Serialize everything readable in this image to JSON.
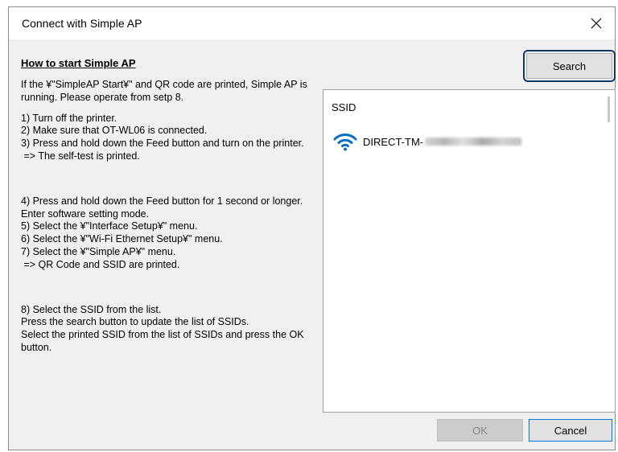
{
  "window": {
    "title": "Connect with Simple AP",
    "close_symbol": "✕"
  },
  "instructions": {
    "heading": "How to start Simple AP",
    "intro": "If the ¥\"SimpleAP Start¥\" and QR code are printed, Simple AP is running. Please operate from setp 8.",
    "steps_a": [
      "1)  Turn off the printer.",
      "2)  Make sure that OT-WL06 is connected.",
      "3)  Press and hold down the Feed button and turn on the printer.",
      " => The self-test is printed."
    ],
    "steps_b": [
      "4)  Press and hold down the Feed button for 1 second or longer. Enter software setting mode.",
      "5)  Select the ¥\"Interface Setup¥\" menu.",
      "6)  Select the ¥\"Wi-Fi Ethernet Setup¥\" menu.",
      "7)  Select the ¥\"Simple AP¥\" menu.",
      " => QR Code and SSID are printed."
    ],
    "steps_c": [
      "8)  Select the SSID from the list.",
      "Press the search button to update the list of SSIDs.",
      "Select the printed SSID from the list of SSIDs and press the OK button."
    ]
  },
  "ssid_list": {
    "header": "SSID",
    "items": [
      {
        "name": "DIRECT-TM-",
        "icon": "wifi-icon"
      }
    ]
  },
  "buttons": {
    "search": "Search",
    "ok": "OK",
    "cancel": "Cancel"
  },
  "colors": {
    "wifi": "#0a6fc2",
    "focus_ring": "#0e3a5f",
    "default_border": "#0078d7"
  }
}
